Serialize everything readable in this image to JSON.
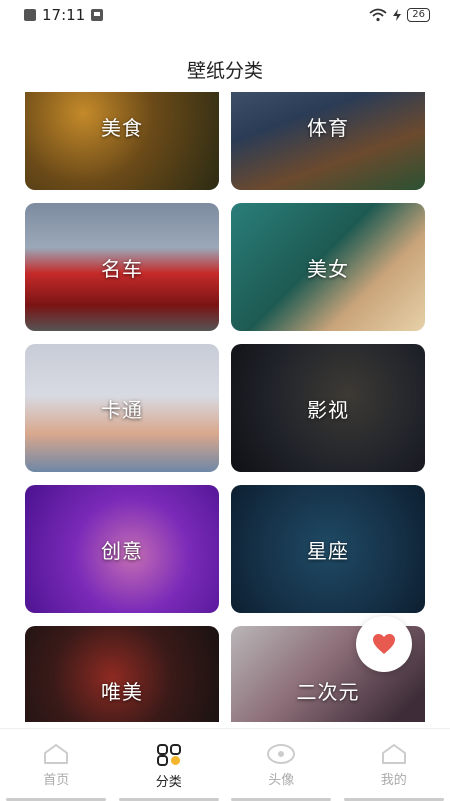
{
  "status_bar": {
    "time": "17:11",
    "battery": "26"
  },
  "page_title": "壁纸分类",
  "categories": [
    {
      "label": "美食"
    },
    {
      "label": "体育"
    },
    {
      "label": "名车"
    },
    {
      "label": "美女"
    },
    {
      "label": "卡通"
    },
    {
      "label": "影视"
    },
    {
      "label": "创意"
    },
    {
      "label": "星座"
    },
    {
      "label": "唯美"
    },
    {
      "label": "二次元"
    }
  ],
  "favorite_button": {
    "icon": "heart-icon",
    "color": "#e85a50"
  },
  "tabbar": {
    "tabs": [
      {
        "label": "首页",
        "icon": "home-icon"
      },
      {
        "label": "分类",
        "icon": "category-icon"
      },
      {
        "label": "头像",
        "icon": "avatar-icon"
      },
      {
        "label": "我的",
        "icon": "profile-icon"
      }
    ],
    "active_color": "#222222",
    "inactive_color": "#aaaaaa",
    "accent": "#f2b52b"
  }
}
